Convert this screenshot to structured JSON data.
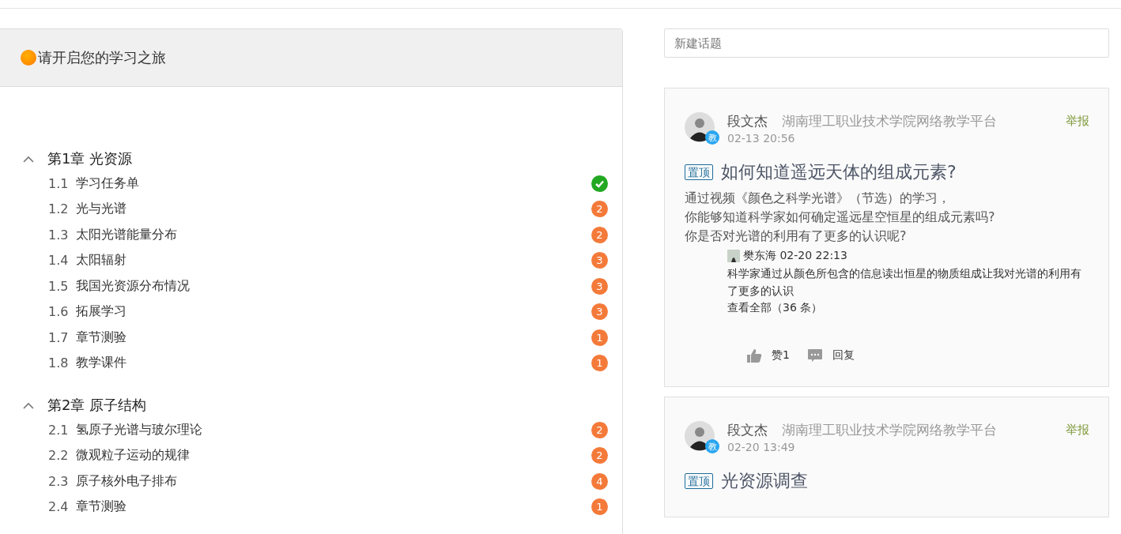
{
  "course_panel": {
    "title": "请开启您的学习之旅",
    "chapters": [
      {
        "title": "第1章 光资源",
        "expanded": true,
        "sections": [
          {
            "number": "1.1",
            "title": "学习任务单",
            "kind": "done"
          },
          {
            "number": "1.2",
            "title": "光与光谱",
            "kind": "pending",
            "count": "2"
          },
          {
            "number": "1.3",
            "title": "太阳光谱能量分布",
            "kind": "pending",
            "count": "2"
          },
          {
            "number": "1.4",
            "title": "太阳辐射",
            "kind": "pending",
            "count": "3"
          },
          {
            "number": "1.5",
            "title": "我国光资源分布情况",
            "kind": "pending",
            "count": "3"
          },
          {
            "number": "1.6",
            "title": "拓展学习",
            "kind": "pending",
            "count": "3"
          },
          {
            "number": "1.7",
            "title": "章节测验",
            "kind": "pending",
            "count": "1"
          },
          {
            "number": "1.8",
            "title": "教学课件",
            "kind": "pending",
            "count": "1"
          }
        ]
      },
      {
        "title": "第2章 原子结构",
        "expanded": true,
        "sections": [
          {
            "number": "2.1",
            "title": "氢原子光谱与玻尔理论",
            "kind": "pending",
            "count": "2"
          },
          {
            "number": "2.2",
            "title": "微观粒子运动的规律",
            "kind": "pending",
            "count": "2"
          },
          {
            "number": "2.3",
            "title": "原子核外电子排布",
            "kind": "pending",
            "count": "4"
          },
          {
            "number": "2.4",
            "title": "章节测验",
            "kind": "pending",
            "count": "1"
          }
        ]
      }
    ]
  },
  "discussion": {
    "new_topic": {
      "placeholder": "新建话题"
    },
    "topics": [
      {
        "author": "段文杰",
        "role_badge": "教",
        "school": "湖南理工职业技术学院网络教学平台",
        "time": "02-13 20:56",
        "report": "举报",
        "pin": "置顶",
        "title": "如何知道遥远天体的组成元素?",
        "body": [
          "通过视频《颜色之科学光谱》（节选）的学习，",
          "你能够知道科学家如何确定遥远星空恒星的组成元素吗?",
          "你是否对光谱的利用有了更多的认识呢?"
        ],
        "replies": [
          {
            "author": "樊东海",
            "time": "02-20 22:13",
            "text": "科学家通过从颜色所包含的信息读出恒星的物质组成让我对光谱的利用有了更多的认识"
          }
        ],
        "view_all": "查看全部（36 条）",
        "like": "赞1",
        "reply": "回复"
      },
      {
        "author": "段文杰",
        "role_badge": "教",
        "school": "湖南理工职业技术学院网络教学平台",
        "time": "02-20 13:49",
        "report": "举报",
        "pin": "置顶",
        "title": "光资源调查"
      }
    ]
  }
}
